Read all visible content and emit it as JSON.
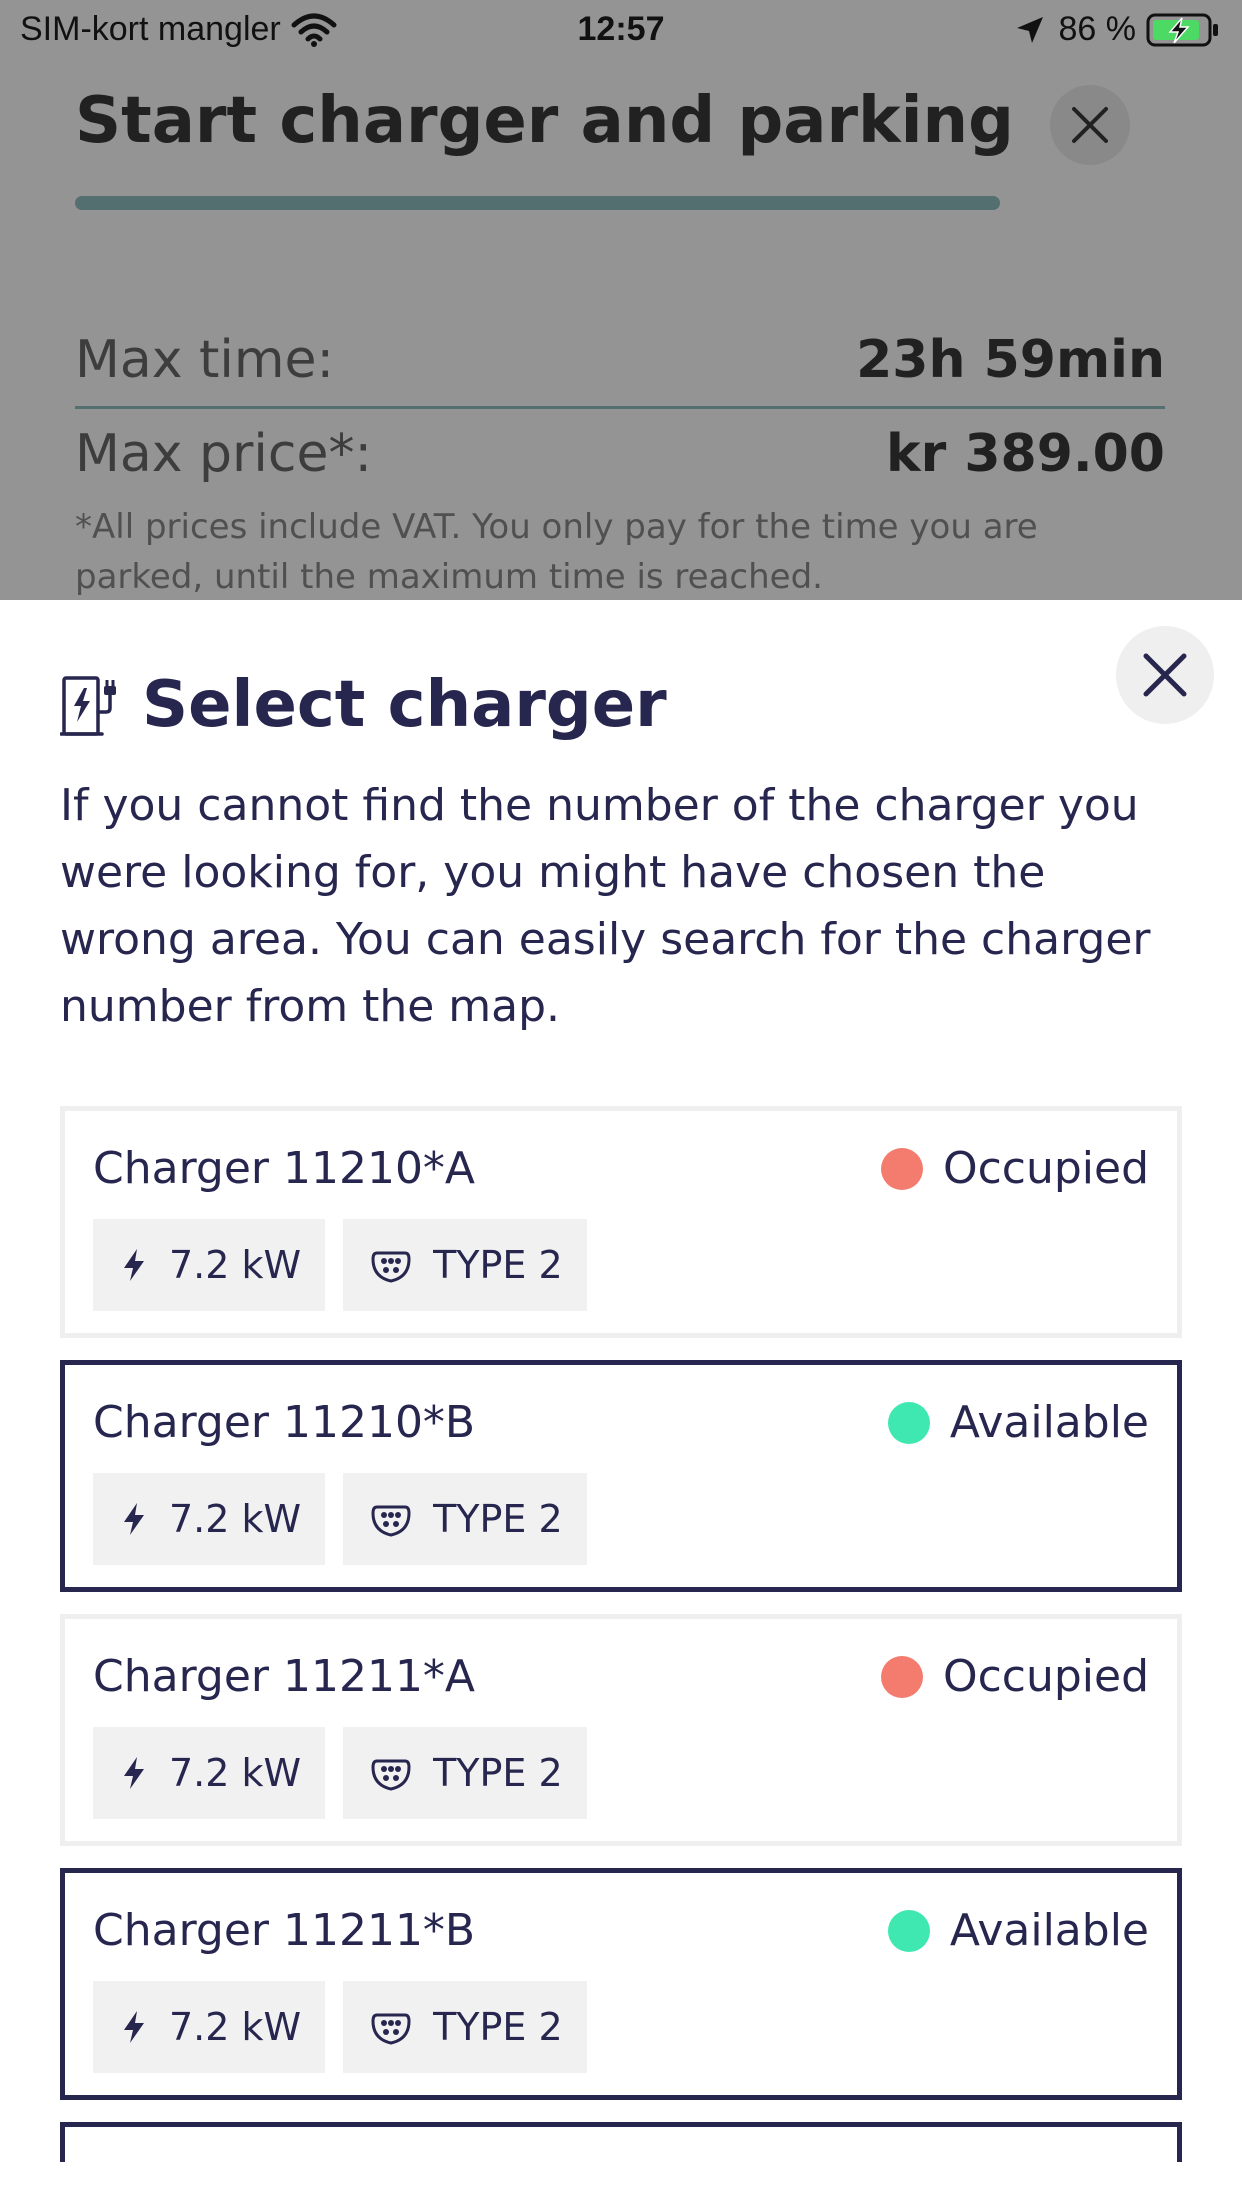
{
  "status_bar": {
    "carrier": "SIM-kort mangler",
    "time": "12:57",
    "battery": "86 %",
    "icons": [
      "wifi-icon",
      "location-arrow-icon",
      "battery-charging-icon"
    ]
  },
  "background_page": {
    "title": "Start charger and parking",
    "max_time_label": "Max time:",
    "max_time_value": "23h 59min",
    "max_price_label": "Max price*:",
    "max_price_value": "kr 389.00",
    "price_note": "*All prices include VAT. You only pay for the time you are parked, until the maximum time is reached."
  },
  "sheet": {
    "title": "Select charger",
    "title_icon": "charger-station-icon",
    "description": "If you cannot find the number of the charger you were looking for, you might have chosen the wrong area. You can easily search for the charger number from the map.",
    "close_icon": "close-icon"
  },
  "chargers": [
    {
      "name": "Charger 11210*A",
      "status": "Occupied",
      "power": "7.2 kW",
      "connector": "TYPE 2"
    },
    {
      "name": "Charger 11210*B",
      "status": "Available",
      "power": "7.2 kW",
      "connector": "TYPE 2"
    },
    {
      "name": "Charger 11211*A",
      "status": "Occupied",
      "power": "7.2 kW",
      "connector": "TYPE 2"
    },
    {
      "name": "Charger 11211*B",
      "status": "Available",
      "power": "7.2 kW",
      "connector": "TYPE 2"
    }
  ],
  "colors": {
    "primary": "#27264f",
    "occupied": "#f47c6e",
    "available": "#3ee8b0",
    "tag_background": "#f1f1f1",
    "battery_fill": "#4cd964"
  }
}
